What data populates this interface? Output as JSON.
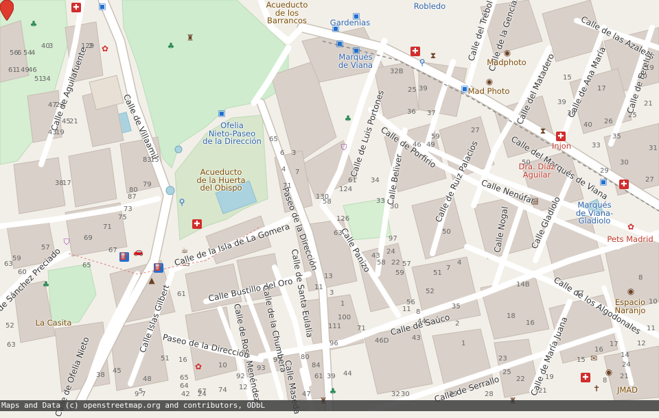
{
  "attribution": "Maps and Data (c) openstreetmap.org and contributors, ODbL",
  "marker": {
    "label": "location-marker",
    "color": "#e03b2f"
  },
  "colors": {
    "background": "#f2efe9",
    "park": "#cfeccf",
    "block": "#e0dad0",
    "building": "#d9d0c9",
    "road": "#ffffff",
    "casing": "#c9c1b6",
    "water": "#aad3df"
  },
  "street_labels": [
    {
      "text": "Calle de Aguilafuente"
    },
    {
      "text": "Calle de Villaamil"
    },
    {
      "text": "Calle de Luis Portones"
    },
    {
      "text": "Calle del Trébol"
    },
    {
      "text": "Calle de la Genciana"
    },
    {
      "text": "Calle de las Azaleas"
    },
    {
      "text": "Calle del Matadero"
    },
    {
      "text": "Calle de Ana María"
    },
    {
      "text": "Calle de Fereluz"
    },
    {
      "text": "Calle de Porfirio"
    },
    {
      "text": "Calle de Ruiz Palacios"
    },
    {
      "text": "Calle del Marqués de Viana"
    },
    {
      "text": "Calle Beliver"
    },
    {
      "text": "Calle Nenúfar"
    },
    {
      "text": "Calle Nogal"
    },
    {
      "text": "Calle Gladiolo"
    },
    {
      "text": "Paseo de la Dirección"
    },
    {
      "text": "Calle de la Isla de La Gomera"
    },
    {
      "text": "Calle Panizo"
    },
    {
      "text": "Calle Bustillo del Oro"
    },
    {
      "text": "Calle de Santa Eulalia"
    },
    {
      "text": "Calle de la Chumbera"
    },
    {
      "text": "Calle de Rosa Menéndez"
    },
    {
      "text": "Calle Islas Gilbert"
    },
    {
      "text": "Calle de Sánchez Preciado"
    },
    {
      "text": "Calle de Ofelia Nieto"
    },
    {
      "text": "Paseo de la Dirección"
    },
    {
      "text": "Calle de Saúco"
    },
    {
      "text": "Calle de Serrallo"
    },
    {
      "text": "Calle de María Juana"
    },
    {
      "text": "Calle de los Algodonales"
    },
    {
      "text": "Calle Maseda"
    }
  ],
  "poi_labels": [
    {
      "text": "Acueducto\nde los\nBarrancos"
    },
    {
      "text": "Gardenias"
    },
    {
      "text": "Robledo"
    },
    {
      "text": "Marqués\nde Viana"
    },
    {
      "text": "Madphoto"
    },
    {
      "text": "Mad Photo"
    },
    {
      "text": "Injon"
    },
    {
      "text": "Dra. Díaz\nAguilar"
    },
    {
      "text": "Marqués\nde Viana-\nGladiolo"
    },
    {
      "text": "Pets Madrid"
    },
    {
      "text": "Ofelia\nNieto-Paseo\nde la Dirección"
    },
    {
      "text": "Acueducto\nde la Huerta\ndel Obispo"
    },
    {
      "text": "La Casita"
    },
    {
      "text": "Espacio\nNaranjo"
    },
    {
      "text": "JMAD"
    }
  ],
  "house_numbers": [
    "56",
    "54",
    "40",
    "129",
    "61",
    "49",
    "51",
    "47",
    "45",
    "43",
    "38",
    "83",
    "80",
    "79",
    "87",
    "73",
    "75",
    "71",
    "69",
    "67",
    "65",
    "63",
    "60",
    "57",
    "59",
    "52",
    "63",
    "61",
    "65",
    "6",
    "3",
    "4",
    "7",
    "71",
    "130",
    "58",
    "126",
    "63",
    "124",
    "61",
    "59",
    "46",
    "49",
    "27",
    "25",
    "37",
    "36",
    "32B",
    "39",
    "34",
    "33",
    "30",
    "97",
    "24",
    "43",
    "58",
    "22",
    "59",
    "57",
    "56",
    "8",
    "52",
    "51",
    "50",
    "4",
    "7",
    "35",
    "2",
    "1",
    "11",
    "71",
    "46D",
    "43",
    "44",
    "37",
    "16",
    "8",
    "24",
    "21",
    "18",
    "16",
    "15",
    "14B",
    "50",
    "40",
    "39",
    "36",
    "35",
    "33",
    "31",
    "30",
    "29",
    "27",
    "26",
    "25",
    "21",
    "20",
    "19",
    "17",
    "15",
    "13",
    "11",
    "3",
    "1",
    "100",
    "111",
    "96",
    "84",
    "80",
    "97",
    "93",
    "92",
    "74",
    "67",
    "65",
    "64",
    "51",
    "48",
    "45",
    "38",
    "16",
    "10",
    "12",
    "5",
    "9",
    "7",
    "42",
    "24",
    "47",
    "61",
    "39",
    "44",
    "32",
    "30",
    "29",
    "28",
    "25",
    "23",
    "22",
    "21",
    "19",
    "17",
    "14",
    "12",
    "11",
    "10",
    "8",
    "6",
    "4",
    "3",
    "2",
    "1",
    "46",
    "34",
    "23",
    "21",
    "19",
    "17",
    "15"
  ]
}
